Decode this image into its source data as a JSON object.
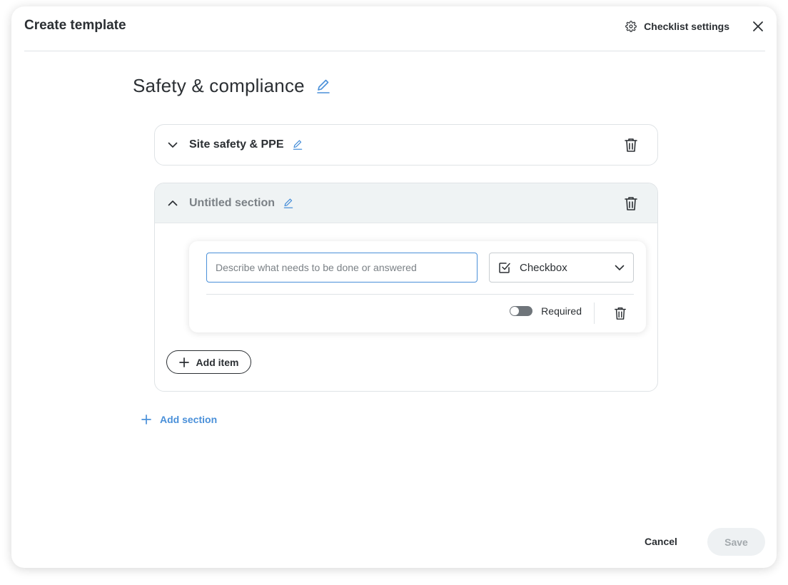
{
  "header": {
    "title": "Create template",
    "settings_label": "Checklist settings"
  },
  "template": {
    "title": "Safety & compliance"
  },
  "sections": [
    {
      "title": "Site safety & PPE",
      "expanded": false
    },
    {
      "title": "Untitled section",
      "expanded": true,
      "items": [
        {
          "placeholder": "Describe what needs to be done or answered",
          "value": "",
          "type": "Checkbox",
          "required_label": "Required",
          "required": false
        }
      ],
      "add_item_label": "Add item"
    }
  ],
  "add_section_label": "Add section",
  "footer": {
    "cancel_label": "Cancel",
    "save_label": "Save"
  },
  "colors": {
    "accent": "#4a90d9",
    "text": "#2b2f33",
    "muted_text": "#7b8186",
    "border": "#dfe3e6",
    "section_header_bg": "#eff3f4",
    "save_disabled_bg": "#eef1f3"
  }
}
